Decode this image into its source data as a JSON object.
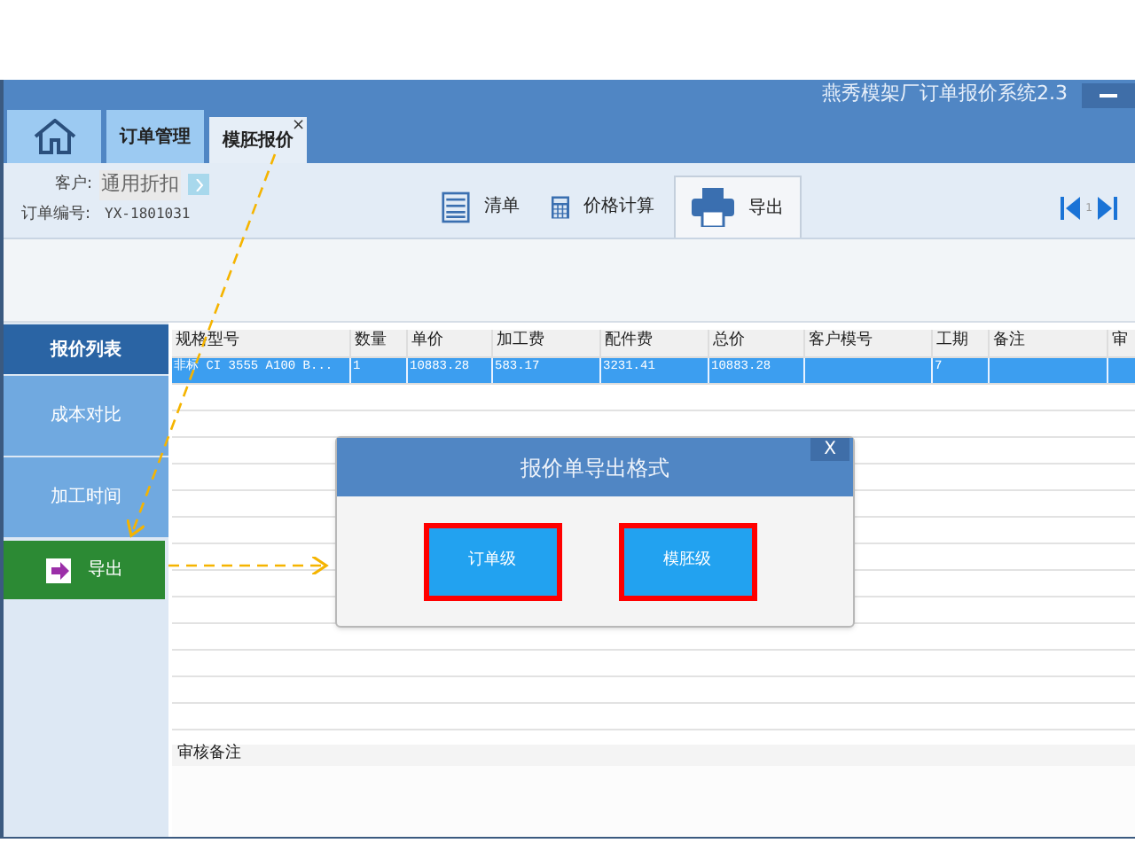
{
  "window": {
    "title": "燕秀模架厂订单报价系统2.3"
  },
  "tabs": [
    {
      "kind": "home",
      "selected": false
    },
    {
      "kind": "text",
      "label": "订单管理",
      "selected": false
    },
    {
      "kind": "text",
      "label": "模胚报价",
      "selected": true,
      "close": "×"
    }
  ],
  "order": {
    "customer_label": "客户:",
    "customer_value": "通用折扣",
    "number_label": "订单编号:",
    "number_value": "YX-1801031"
  },
  "toolbar": [
    {
      "kind": "list",
      "label": "清单",
      "selected": false
    },
    {
      "kind": "calculator",
      "label": "价格计算",
      "selected": false
    },
    {
      "kind": "printer",
      "label": "导出",
      "selected": true
    }
  ],
  "pager": {
    "page": "1"
  },
  "sidebar": {
    "items": [
      {
        "kind": "tab",
        "label": "报价列表",
        "selected": true
      },
      {
        "kind": "tab",
        "label": "成本对比",
        "selected": false
      },
      {
        "kind": "tab",
        "label": "加工时间",
        "selected": false
      },
      {
        "kind": "action",
        "label": "导出",
        "selected": false
      }
    ]
  },
  "table": {
    "columns": [
      "规格型号",
      "数量",
      "单价",
      "加工费",
      "配件费",
      "总价",
      "客户模号",
      "工期",
      "备注",
      "审"
    ],
    "rows": [
      {
        "selected": true,
        "cells": [
          "非标 CI 3555 A100 B...",
          "1",
          "10883.28",
          "583.17",
          "3231.41",
          "10883.28",
          "",
          "7",
          "",
          ""
        ]
      }
    ]
  },
  "review": {
    "label": "审核备注"
  },
  "dialog": {
    "title": "报价单导出格式",
    "close": "X",
    "buttons": [
      "订单级",
      "模胚级"
    ]
  }
}
